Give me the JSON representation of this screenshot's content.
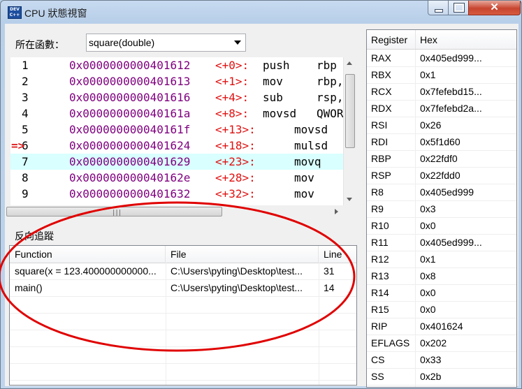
{
  "window": {
    "title": "CPU 狀態視窗",
    "app_icon_text": "DEV C++"
  },
  "caption": {
    "close_glyph": "✕"
  },
  "function_selector": {
    "label": "所在函數：",
    "value": "square(double)"
  },
  "disassembly": {
    "current_marker": "=>",
    "lines": [
      {
        "num": "1",
        "addr": "0x0000000000401612",
        "offset": "<+0>:",
        "op": "push",
        "arg": "rbp"
      },
      {
        "num": "2",
        "addr": "0x0000000000401613",
        "offset": "<+1>:",
        "op": "mov",
        "arg": "rbp,"
      },
      {
        "num": "3",
        "addr": "0x0000000000401616",
        "offset": "<+4>:",
        "op": "sub",
        "arg": "rsp,"
      },
      {
        "num": "4",
        "addr": "0x000000000040161a",
        "offset": "<+8>:",
        "op": "movsd",
        "arg": "QWOR"
      },
      {
        "num": "5",
        "addr": "0x000000000040161f",
        "offset": "<+13>:",
        "op": "movsd",
        "arg": ""
      },
      {
        "num": "6",
        "addr": "0x0000000000401624",
        "offset": "<+18>:",
        "op": "mulsd",
        "arg": ""
      },
      {
        "num": "7",
        "addr": "0x0000000000401629",
        "offset": "<+23>:",
        "op": "movq",
        "arg": ""
      },
      {
        "num": "8",
        "addr": "0x000000000040162e",
        "offset": "<+28>:",
        "op": "mov",
        "arg": ""
      },
      {
        "num": "9",
        "addr": "0x0000000000401632",
        "offset": "<+32>:",
        "op": "mov",
        "arg": ""
      }
    ]
  },
  "backtrace": {
    "label": "反向追蹤",
    "columns": [
      "Function",
      "File",
      "Line"
    ],
    "rows": [
      {
        "function": "square(x = 123.400000000000...",
        "file": "C:\\Users\\pyting\\Desktop\\test...",
        "line": "31"
      },
      {
        "function": "main()",
        "file": "C:\\Users\\pyting\\Desktop\\test...",
        "line": "14"
      }
    ]
  },
  "registers": {
    "columns": [
      "Register",
      "Hex"
    ],
    "rows": [
      {
        "name": "RAX",
        "hex": "0x405ed999..."
      },
      {
        "name": "RBX",
        "hex": "0x1"
      },
      {
        "name": "RCX",
        "hex": "0x7fefebd15..."
      },
      {
        "name": "RDX",
        "hex": "0x7fefebd2a..."
      },
      {
        "name": "RSI",
        "hex": "0x26"
      },
      {
        "name": "RDI",
        "hex": "0x5f1d60"
      },
      {
        "name": "RBP",
        "hex": "0x22fdf0"
      },
      {
        "name": "RSP",
        "hex": "0x22fdd0"
      },
      {
        "name": "R8",
        "hex": "0x405ed999"
      },
      {
        "name": "R9",
        "hex": "0x3"
      },
      {
        "name": "R10",
        "hex": "0x0"
      },
      {
        "name": "R11",
        "hex": "0x405ed999..."
      },
      {
        "name": "R12",
        "hex": "0x1"
      },
      {
        "name": "R13",
        "hex": "0x8"
      },
      {
        "name": "R14",
        "hex": "0x0"
      },
      {
        "name": "R15",
        "hex": "0x0"
      },
      {
        "name": "RIP",
        "hex": "0x401624"
      },
      {
        "name": "EFLAGS",
        "hex": "0x202"
      },
      {
        "name": "CS",
        "hex": "0x33"
      },
      {
        "name": "SS",
        "hex": "0x2b"
      }
    ]
  },
  "colors": {
    "address": "#800080",
    "offset": "#e01010",
    "current_marker": "#e02020",
    "highlight_row": "#d9ffff",
    "annotation_ellipse": "#e00000"
  }
}
